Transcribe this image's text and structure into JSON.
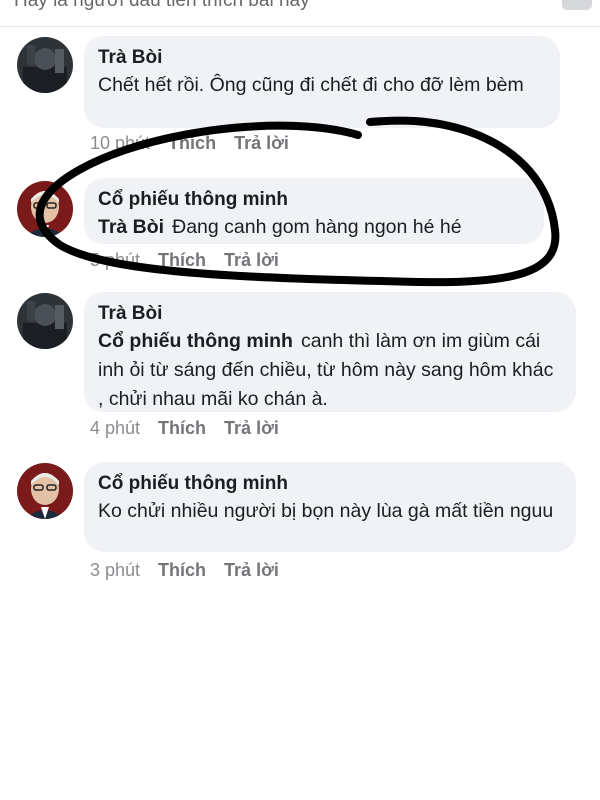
{
  "header": {
    "hint": "Hãy là người đầu tiên thích bài này"
  },
  "comments": [
    {
      "author": "Trà Bòi",
      "mention": "",
      "text": "Chết hết rồi. Ông cũng đi chết đi cho đỡ lèm bèm",
      "time": "10 phút",
      "like": "Thích",
      "reply": "Trả lời",
      "avatar": "dark-avatar"
    },
    {
      "author": "Cổ phiếu thông minh",
      "mention": "Trà Bòi",
      "text": "Đang canh gom hàng ngon hé hé",
      "time": "5 phút",
      "like": "Thích",
      "reply": "Trả lời",
      "avatar": "old-man-avatar"
    },
    {
      "author": "Trà Bòi",
      "mention": "Cổ phiếu thông minh",
      "text": "canh thì làm ơn im giùm cái  inh ỏi từ sáng đến chiều, từ hôm này sang hôm khác , chửi nhau mãi ko chán à.",
      "time": "4 phút",
      "like": "Thích",
      "reply": "Trả lời",
      "avatar": "dark-avatar"
    },
    {
      "author": "Cổ phiếu thông minh",
      "mention": "",
      "text": "Ko chửi nhiều người bị bọn này lùa gà mất tiền nguu",
      "time": "3 phút",
      "like": "Thích",
      "reply": "Trả lời",
      "avatar": "old-man-avatar"
    }
  ],
  "colors": {
    "bubble": "#f0f2f5",
    "meta": "#8a8d91",
    "annotation": "#000000"
  }
}
